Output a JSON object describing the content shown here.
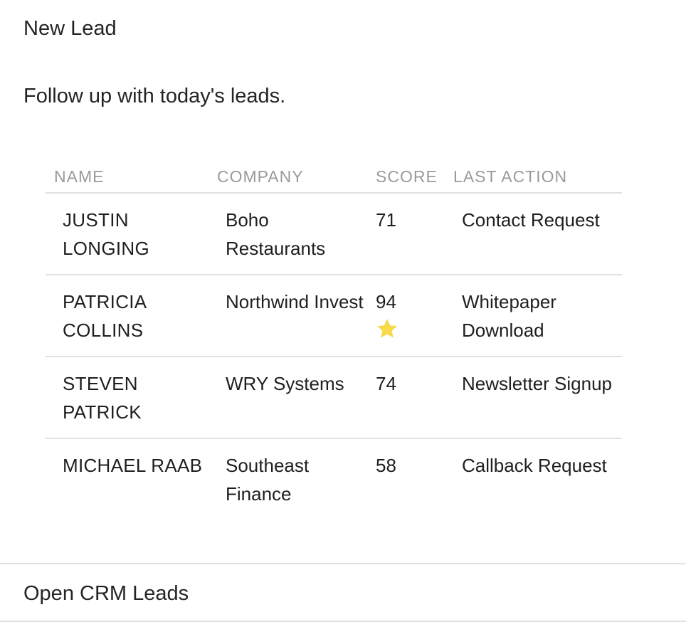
{
  "card": {
    "title": "New Lead",
    "subtitle": "Follow up with today's leads."
  },
  "table": {
    "headers": {
      "name": "NAME",
      "company": "COMPANY",
      "score": "SCORE",
      "last_action": "LAST ACTION"
    },
    "rows": [
      {
        "name": "JUSTIN LONGING",
        "company": "Boho Restaurants",
        "score": "71",
        "last_action": "Contact Request",
        "starred": false
      },
      {
        "name": "PATRICIA COLLINS",
        "company": "Northwind Invest",
        "score": "94",
        "last_action": "Whitepaper Download",
        "starred": true
      },
      {
        "name": "STEVEN PATRICK",
        "company": "WRY Systems",
        "score": "74",
        "last_action": "Newsletter Signup",
        "starred": false
      },
      {
        "name": "MICHAEL RAAB",
        "company": "Southeast Finance",
        "score": "58",
        "last_action": "Callback Request",
        "starred": false
      }
    ]
  },
  "footer": {
    "link_label": "Open CRM Leads"
  },
  "colors": {
    "star": "#f7d949",
    "divider": "#e1e1e1",
    "header_text": "#9a9a9a"
  },
  "icons": {
    "star": "star-icon"
  }
}
